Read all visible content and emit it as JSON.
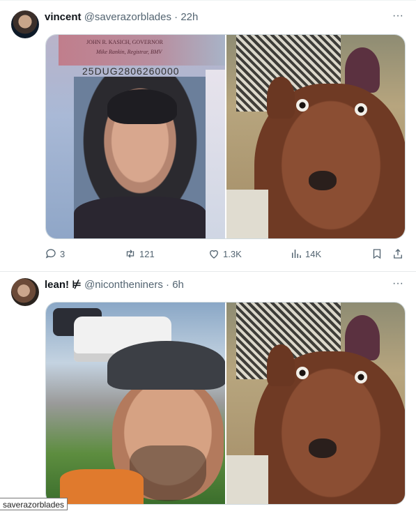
{
  "tweets": [
    {
      "name": "vincent",
      "handle": "@saverazorblades",
      "dot": "·",
      "time": "22h",
      "media": {
        "license_text_line1": "JOHN R. KASICH, GOVERNOR",
        "license_text_line2": "Mike Rankin, Registrar, BMV",
        "license_number": "25DUG2806260000"
      },
      "actions": {
        "replies": "3",
        "retweets": "121",
        "likes": "1.3K",
        "views": "14K"
      }
    },
    {
      "name": "lean! ⊭",
      "handle": "@nicontheniners",
      "dot": "·",
      "time": "6h"
    }
  ],
  "more_label": "···",
  "status_tooltip": "saverazorblades",
  "colors": {
    "secondary_text": "#536471",
    "primary_text": "#0f1419",
    "border": "#cfd9de"
  },
  "icons": [
    "more-icon",
    "reply-icon",
    "retweet-icon",
    "like-icon",
    "views-icon",
    "bookmark-icon",
    "share-icon"
  ]
}
